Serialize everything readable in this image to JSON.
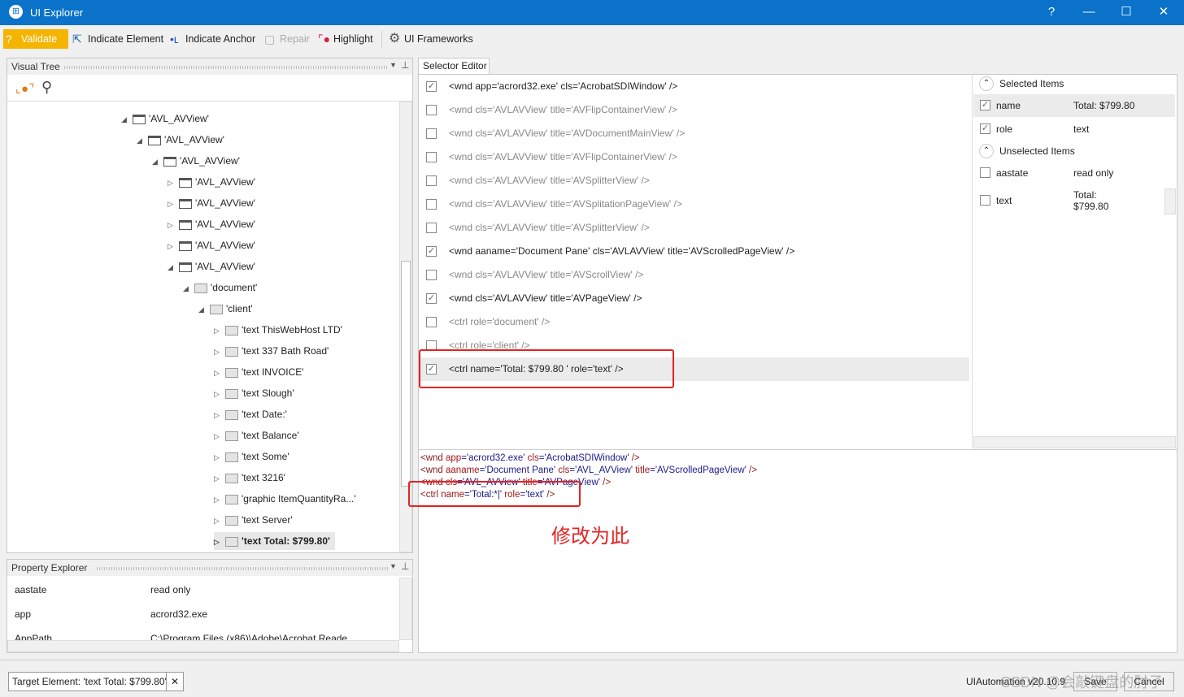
{
  "window": {
    "title": "UI Explorer",
    "help": "?",
    "minimize": "—",
    "maximize": "☐",
    "close": "✕"
  },
  "toolbar": {
    "validate": "Validate",
    "indicate_element": "Indicate Element",
    "indicate_anchor": "Indicate Anchor",
    "repair": "Repair",
    "highlight": "Highlight",
    "ui_frameworks": "UI Frameworks"
  },
  "visual_tree": {
    "title": "Visual Tree",
    "nodes": [
      {
        "label": "'AVL_AVView'",
        "level": 0,
        "state": "expanded",
        "icon": "window"
      },
      {
        "label": "'AVL_AVView'",
        "level": 1,
        "state": "expanded",
        "icon": "window"
      },
      {
        "label": "'AVL_AVView'",
        "level": 2,
        "state": "expanded",
        "icon": "window"
      },
      {
        "label": "'AVL_AVView'",
        "level": 3,
        "state": "collapsed",
        "icon": "window"
      },
      {
        "label": "'AVL_AVView'",
        "level": 3,
        "state": "collapsed",
        "icon": "window"
      },
      {
        "label": "'AVL_AVView'",
        "level": 3,
        "state": "collapsed",
        "icon": "window"
      },
      {
        "label": "'AVL_AVView'",
        "level": 3,
        "state": "collapsed",
        "icon": "window"
      },
      {
        "label": "'AVL_AVView'",
        "level": 3,
        "state": "expanded",
        "icon": "window"
      },
      {
        "label": "'document'",
        "level": 4,
        "state": "expanded",
        "icon": "control"
      },
      {
        "label": "'client'",
        "level": 5,
        "state": "expanded",
        "icon": "control"
      },
      {
        "label": "'text  ThisWebHost LTD'",
        "level": 6,
        "state": "collapsed",
        "icon": "control"
      },
      {
        "label": "'text  337 Bath Road'",
        "level": 6,
        "state": "collapsed",
        "icon": "control"
      },
      {
        "label": "'text  INVOICE'",
        "level": 6,
        "state": "collapsed",
        "icon": "control"
      },
      {
        "label": "'text Slough'",
        "level": 6,
        "state": "collapsed",
        "icon": "control"
      },
      {
        "label": "'text Date:'",
        "level": 6,
        "state": "collapsed",
        "icon": "control"
      },
      {
        "label": "'text Balance'",
        "level": 6,
        "state": "collapsed",
        "icon": "control"
      },
      {
        "label": "'text Some'",
        "level": 6,
        "state": "collapsed",
        "icon": "control"
      },
      {
        "label": "'text 3216'",
        "level": 6,
        "state": "collapsed",
        "icon": "control"
      },
      {
        "label": "'graphic  ItemQuantityRa...'",
        "level": 6,
        "state": "collapsed",
        "icon": "control"
      },
      {
        "label": "'text Server'",
        "level": 6,
        "state": "collapsed",
        "icon": "control"
      },
      {
        "label": "'text  Total: $799.80'",
        "level": 6,
        "state": "collapsed",
        "icon": "control",
        "selected": true
      }
    ]
  },
  "property_explorer": {
    "title": "Property Explorer",
    "rows": [
      {
        "name": "aastate",
        "value": "read only"
      },
      {
        "name": "app",
        "value": "acrord32.exe"
      },
      {
        "name": "AppPath",
        "value": "C:\\Program Files (x86)\\Adobe\\Acrobat Reade"
      }
    ]
  },
  "selector_editor": {
    "tab": "Selector Editor",
    "rows": [
      {
        "text": "<wnd app='acrord32.exe' cls='AcrobatSDIWindow' />",
        "checked": true
      },
      {
        "text": "<wnd cls='AVLAVView' title='AVFlipContainerView' />",
        "checked": false
      },
      {
        "text": "<wnd cls='AVLAVView' title='AVDocumentMainView' />",
        "checked": false
      },
      {
        "text": "<wnd cls='AVLAVView' title='AVFlipContainerView' />",
        "checked": false
      },
      {
        "text": "<wnd cls='AVLAVView' title='AVSplitterView' />",
        "checked": false
      },
      {
        "text": "<wnd cls='AVLAVView' title='AVSplitationPageView' />",
        "checked": false
      },
      {
        "text": "<wnd cls='AVLAVView' title='AVSplitterView' />",
        "checked": false
      },
      {
        "text": "<wnd aaname='Document Pane' cls='AVLAVView' title='AVScrolledPageView' />",
        "checked": true
      },
      {
        "text": "<wnd cls='AVLAVView' title='AVScrollView' />",
        "checked": false
      },
      {
        "text": "<wnd cls='AVLAVView' title='AVPageView' />",
        "checked": true
      },
      {
        "text": "<ctrl role='document' />",
        "checked": false
      },
      {
        "text": "<ctrl role='client' />",
        "checked": false
      },
      {
        "text": "<ctrl name='Total:   $799.80   ' role='text' />",
        "checked": true,
        "highlighted": true
      }
    ],
    "selected_header": "Selected Items",
    "unselected_header": "Unselected Items",
    "selected_items": [
      {
        "name": "name",
        "value": "Total:   $799.80",
        "checked": true
      },
      {
        "name": "role",
        "value": "text",
        "checked": true
      }
    ],
    "unselected_items": [
      {
        "name": "aastate",
        "value": "read only",
        "checked": false
      },
      {
        "name": "text",
        "value": "Total:\n$799.80",
        "checked": false
      }
    ],
    "xml": [
      [
        [
          "tagc",
          "<wnd "
        ],
        [
          "k",
          "app"
        ],
        [
          "v",
          "='acrord32.exe' "
        ],
        [
          "k",
          "cls"
        ],
        [
          "v",
          "='AcrobatSDIWindow' "
        ],
        [
          "tagc",
          "/>"
        ]
      ],
      [
        [
          "tagc",
          "<wnd "
        ],
        [
          "k",
          "aaname"
        ],
        [
          "v",
          "='Document Pane' "
        ],
        [
          "k",
          "cls"
        ],
        [
          "v",
          "='AVL_AVView' "
        ],
        [
          "k",
          "title"
        ],
        [
          "v",
          "='AVScrolledPageView' "
        ],
        [
          "tagc",
          "/>"
        ]
      ],
      [
        [
          "tagc",
          "<wnd "
        ],
        [
          "k",
          "cls"
        ],
        [
          "v",
          "='AVL_AVView' "
        ],
        [
          "k",
          "title"
        ],
        [
          "v",
          "='AVPageView' "
        ],
        [
          "tagc",
          "/>"
        ]
      ],
      [
        [
          "tagc",
          "<ctrl "
        ],
        [
          "k",
          "name"
        ],
        [
          "v",
          "='Total:*|' "
        ],
        [
          "k",
          "role"
        ],
        [
          "v",
          "='text' "
        ],
        [
          "tagc",
          "/>"
        ]
      ]
    ]
  },
  "annotation": "修改为此",
  "status": {
    "target_element": "Target Element: 'text  Total: $799.80'",
    "framework": "UIAutomation v20.10.9",
    "save": "Save",
    "cancel": "Cancel"
  },
  "watermark": "CSDN @会敲键盘的肘子",
  "colors": {
    "titlebar": "#0a72c9",
    "validate": "#f5b400",
    "annotation": "#e52222"
  }
}
